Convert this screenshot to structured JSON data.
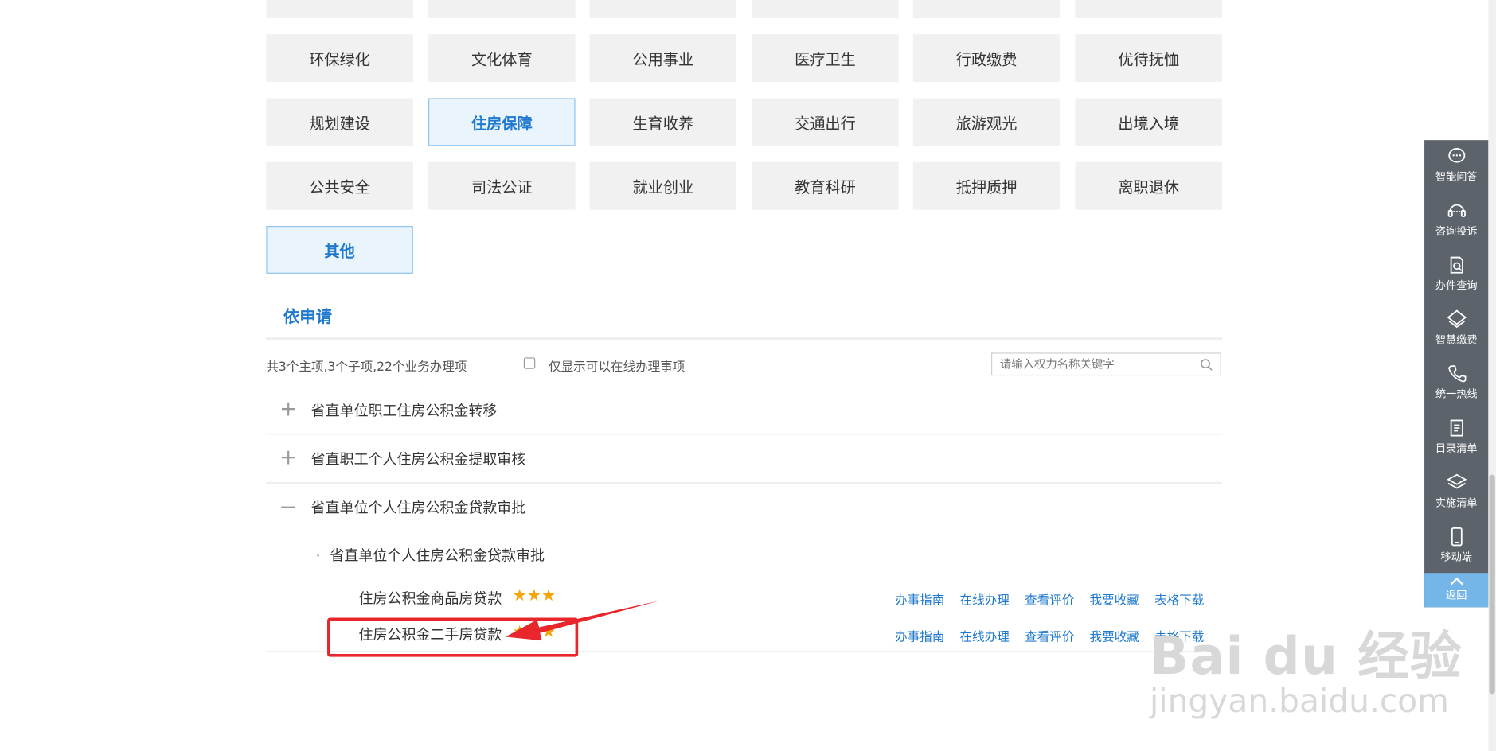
{
  "categories": {
    "row1": [
      "环保绿化",
      "文化体育",
      "公用事业",
      "医疗卫生",
      "行政缴费",
      "优待抚恤"
    ],
    "row2": [
      "规划建设",
      "住房保障",
      "生育收养",
      "交通出行",
      "旅游观光",
      "出境入境"
    ],
    "row3": [
      "公共安全",
      "司法公证",
      "就业创业",
      "教育科研",
      "抵押质押",
      "离职退休"
    ],
    "row4": [
      "其他"
    ]
  },
  "section": {
    "title": "依申请",
    "summary": "共3个主项,3个子项,22个业务办理项",
    "checkbox_label": "仅显示可以在线办理事项",
    "search_placeholder": "请输入权力名称关键字"
  },
  "items": [
    {
      "toggle": "+",
      "label": "省直单位职工住房公积金转移"
    },
    {
      "toggle": "+",
      "label": "省直职工个人住房公积金提取审核"
    },
    {
      "toggle": "—",
      "label": "省直单位个人住房公积金贷款审批"
    }
  ],
  "sub_item": {
    "bullet": "·",
    "label": "省直单位个人住房公积金贷款审批",
    "entries": [
      {
        "label": "住房公积金商品房贷款",
        "stars": "★★★",
        "rating": 3
      },
      {
        "label": "住房公积金二手房贷款",
        "stars": "★★★",
        "rating": 3
      }
    ],
    "actions": [
      "办事指南",
      "在线办理",
      "查看评价",
      "我要收藏",
      "表格下载"
    ]
  },
  "toolbar": {
    "items": [
      {
        "label": "智能问答",
        "icon": "chat-icon"
      },
      {
        "label": "咨询投诉",
        "icon": "headset-icon"
      },
      {
        "label": "办件查询",
        "icon": "doc-search-icon"
      },
      {
        "label": "智慧缴费",
        "icon": "payment-icon"
      },
      {
        "label": "统一热线",
        "icon": "phone-icon"
      },
      {
        "label": "目录清单",
        "icon": "list-icon"
      },
      {
        "label": "实施清单",
        "icon": "layers-icon"
      },
      {
        "label": "移动端",
        "icon": "mobile-icon"
      }
    ],
    "back_label": "返回"
  },
  "watermark": {
    "main": "Bai du 经验",
    "sub": "jingyan.baidu.com"
  },
  "colors": {
    "accent": "#1e79cf",
    "star": "#f5a50a",
    "annotation": "#e8262b",
    "toolbar": "#5d636b",
    "back": "#73b6e7"
  }
}
